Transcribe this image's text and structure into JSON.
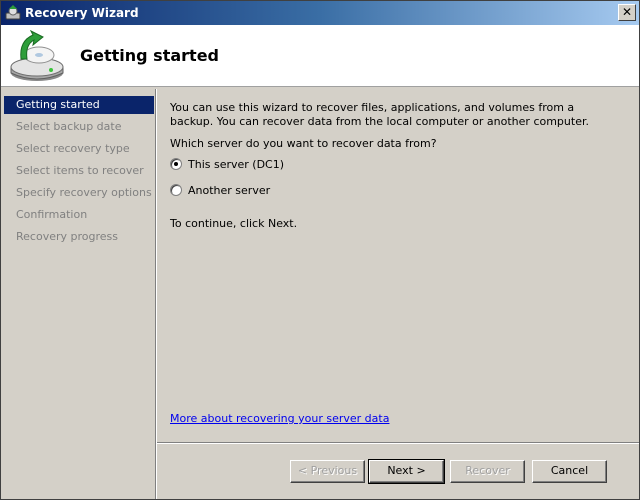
{
  "window": {
    "title": "Recovery Wizard",
    "close_glyph": "✕"
  },
  "header": {
    "page_title": "Getting started",
    "icon": "disk-recovery-icon"
  },
  "nav": {
    "items": [
      {
        "label": "Getting started",
        "active": true
      },
      {
        "label": "Select backup date",
        "active": false
      },
      {
        "label": "Select recovery type",
        "active": false
      },
      {
        "label": "Select items to recover",
        "active": false
      },
      {
        "label": "Specify recovery options",
        "active": false
      },
      {
        "label": "Confirmation",
        "active": false
      },
      {
        "label": "Recovery progress",
        "active": false
      }
    ]
  },
  "content": {
    "intro": "You can use this wizard to recover files, applications, and volumes from a backup. You can recover data from the local computer or another computer.",
    "question": "Which server do you want to recover data from?",
    "options": [
      {
        "label": "This server (DC1)",
        "checked": true
      },
      {
        "label": "Another server",
        "checked": false
      }
    ],
    "continue_text": "To continue, click Next.",
    "more_link": "More about recovering your server data"
  },
  "buttons": {
    "previous": "< Previous",
    "next": "Next >",
    "recover": "Recover",
    "cancel": "Cancel"
  },
  "colors": {
    "selection": "#0a246a",
    "link": "#0000ee",
    "disabled_text": "#a0a0a0"
  }
}
